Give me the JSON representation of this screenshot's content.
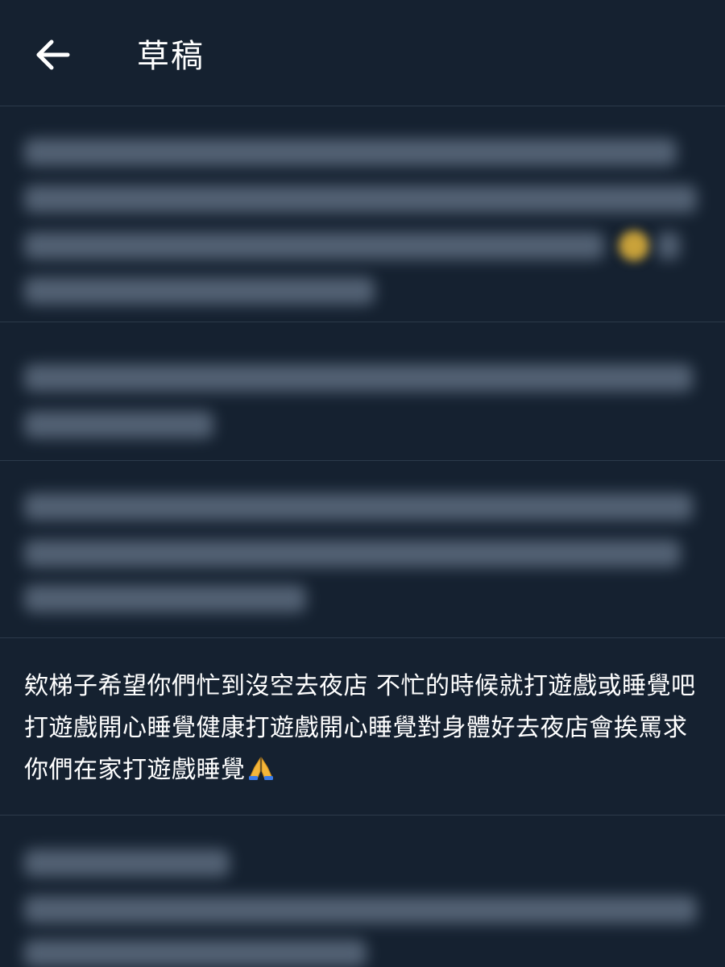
{
  "header": {
    "title": "草稿",
    "back_icon": "arrow-left-icon"
  },
  "drafts": [
    {
      "blurred": true
    },
    {
      "blurred": true
    },
    {
      "blurred": true
    },
    {
      "blurred": false,
      "text": "欸梯子希望你們忙到沒空去夜店 不忙的時候就打遊戲或睡覺吧打遊戲開心睡覺健康打遊戲開心睡覺對身體好去夜店會挨罵求你們在家打遊戲睡覺",
      "emoji": "folded-hands-icon"
    },
    {
      "blurred": true
    }
  ],
  "colors": {
    "background": "#152130",
    "divider": "#2c3a4a",
    "text": "#ffffff"
  }
}
